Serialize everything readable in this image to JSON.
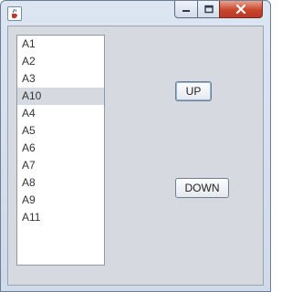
{
  "window": {
    "icons": {
      "app": "java-cup-icon",
      "minimize": "minimize-icon",
      "maximize": "maximize-icon",
      "close": "close-icon"
    }
  },
  "list": {
    "items": [
      "A1",
      "A2",
      "A3",
      "A10",
      "A4",
      "A5",
      "A6",
      "A7",
      "A8",
      "A9",
      "A11"
    ],
    "selected_index": 3
  },
  "buttons": {
    "up_label": "UP",
    "down_label": "DOWN"
  },
  "colors": {
    "panel_bg": "#d6d9df",
    "selection_bg": "#d6d9df",
    "close_button": "#c8452d"
  }
}
